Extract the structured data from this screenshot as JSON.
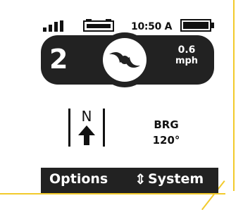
{
  "status_bar": {
    "time": "10:50 A",
    "signal_icon": "signal-bars-icon",
    "gps_icon": "gps-receiver-icon",
    "battery_icon": "battery-full-icon"
  },
  "main_panel": {
    "count": "2",
    "center_icon": "swirl-fan-icon",
    "speed_value": "0.6",
    "speed_unit": "mph"
  },
  "compass": {
    "label": "N",
    "icon": "north-arrow-icon"
  },
  "bearing": {
    "label": "BRG",
    "value": "120°"
  },
  "menu": {
    "left_label": "Options",
    "arrows": "⇕",
    "right_label": "System"
  },
  "colors": {
    "panel": "#222222",
    "frame": "#f2ca2c",
    "text": "#111111"
  }
}
